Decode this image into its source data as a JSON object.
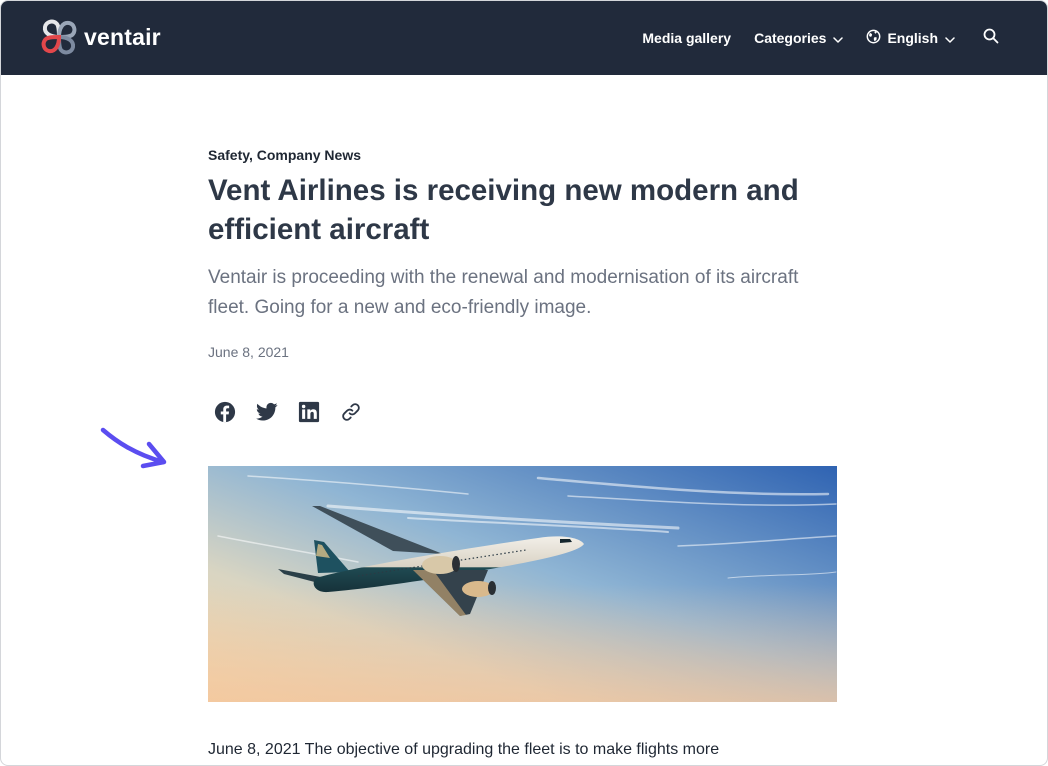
{
  "header": {
    "brand": "ventair",
    "nav": {
      "media_gallery": "Media gallery",
      "categories": "Categories",
      "language": "English"
    },
    "icons": [
      "logo-icon",
      "chevron-down-icon",
      "globe-icon",
      "search-icon"
    ]
  },
  "article": {
    "categories": "Safety, Company News",
    "title": "Vent Airlines is receiving new modern and efficient aircraft",
    "subtitle": "Ventair is proceeding with the renewal and modernisation of its aircraft fleet. Going for a new and eco-friendly image.",
    "date": "June 8, 2021",
    "share_icons": [
      "facebook-icon",
      "twitter-icon",
      "linkedin-icon",
      "link-icon"
    ],
    "body_first_line": "June 8, 2021 The objective of upgrading the fleet is to make flights more"
  },
  "colors": {
    "header_bg": "#212a3b",
    "annotation_arrow": "#5b4df0",
    "title_text": "#2e3847",
    "muted_text": "#6b7280"
  }
}
